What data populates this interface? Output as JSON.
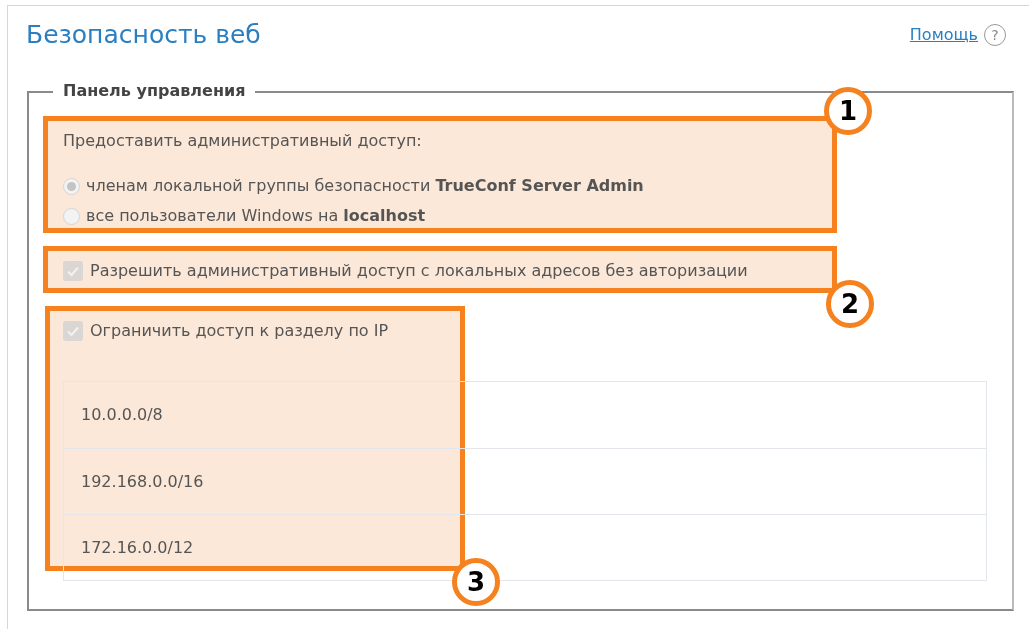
{
  "title": "Безопасность веб",
  "help": {
    "link": "Помощь",
    "icon": "?"
  },
  "panel": {
    "legend": "Панель управления",
    "access": {
      "label": "Предоставить административный доступ:",
      "options": [
        {
          "text": "членам локальной группы безопасности **TrueConf Server Admin**",
          "selected": true,
          "disabled": true
        },
        {
          "text": "все пользователи Windows на **localhost**",
          "selected": false,
          "disabled": true
        }
      ]
    },
    "checkboxes": [
      {
        "label": "Разрешить административный доступ с локальных адресов без авторизации",
        "checked": true,
        "disabled": true
      },
      {
        "label": "Ограничить доступ к разделу по IP",
        "checked": true,
        "disabled": true
      }
    ],
    "ip_table": {
      "rows": [
        "10.0.0.0/8",
        "192.168.0.0/16",
        "172.16.0.0/12"
      ]
    }
  },
  "callouts": [
    {
      "number": "1"
    },
    {
      "number": "2"
    },
    {
      "number": "3"
    }
  ]
}
